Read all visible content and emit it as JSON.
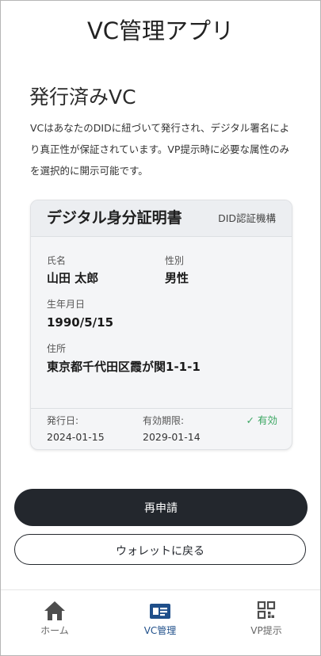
{
  "app": {
    "title": "VC管理アプリ"
  },
  "section": {
    "title": "発行済みVC",
    "description": "VCはあなたのDIDに紐づいて発行され、デジタル署名により真正性が保証されています。VP提示時に必要な属性のみを選択的に開示可能です。"
  },
  "card": {
    "title": "デジタル身分証明書",
    "issuer": "DID認証機構",
    "attributes": {
      "name": {
        "label": "氏名",
        "value": "山田 太郎"
      },
      "gender": {
        "label": "性別",
        "value": "男性"
      },
      "birthdate": {
        "label": "生年月日",
        "value": "1990/5/15"
      },
      "address": {
        "label": "住所",
        "value": "東京都千代田区霞が関1-1-1"
      }
    },
    "footer": {
      "issued_label": "発行日:",
      "issued_value": "2024-01-15",
      "expiry_label": "有効期限:",
      "expiry_value": "2029-01-14",
      "status": "✓ 有効",
      "status_color": "#3aa662"
    }
  },
  "actions": {
    "reapply_label": "再申請",
    "back_label": "ウォレットに戻る"
  },
  "tabbar": {
    "items": [
      {
        "label": "ホーム",
        "icon": "home-icon",
        "active": false
      },
      {
        "label": "VC管理",
        "icon": "id-card-icon",
        "active": true
      },
      {
        "label": "VP提示",
        "icon": "qr-code-icon",
        "active": false
      }
    ],
    "active_color": "#1f4f8a",
    "inactive_color": "#666666"
  }
}
